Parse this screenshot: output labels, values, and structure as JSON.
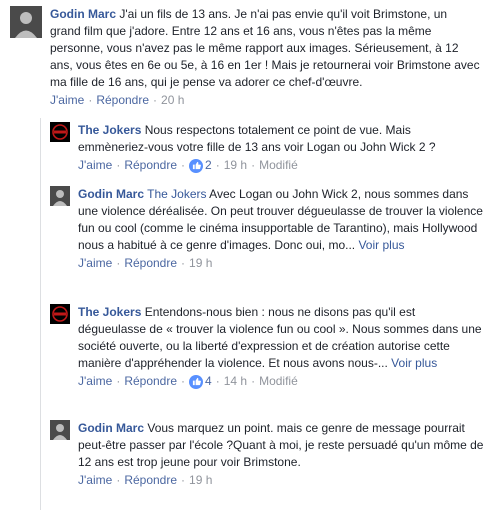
{
  "colors": {
    "link": "#365899",
    "meta": "#90949c",
    "like_badge": "#5890ff"
  },
  "comments": [
    {
      "author": "Godin Marc",
      "mention": "",
      "text": "J'ai un fils de 13 ans. Je n'ai pas envie qu'il voit Brimstone, un grand film que j'adore. Entre 12 ans et 16 ans, vous n'êtes pas la même personne, vous n'avez pas le même rapport aux images. Sérieusement, à 12 ans, vous êtes en 6e ou 5e, à 16 en 1er ! Mais je retournerai voir Brimstone avec ma fille de 16 ans, qui je pense va adorer ce chef-d'œuvre.",
      "seemore": "",
      "like": "J'aime",
      "reply": "Répondre",
      "likes": "",
      "time": "20 h",
      "edited": ""
    },
    {
      "author": "The Jokers",
      "mention": "",
      "text": "Nous respectons totalement ce point de vue. Mais emmèneriez-vous votre fille de 13 ans voir Logan ou John Wick 2 ?",
      "seemore": "",
      "like": "J'aime",
      "reply": "Répondre",
      "likes": "2",
      "time": "19 h",
      "edited": "Modifié"
    },
    {
      "author": "Godin Marc",
      "mention": "The Jokers",
      "text": "Avec Logan ou John Wick 2, nous sommes dans une violence déréalisée. On peut trouver dégueulasse de trouver la violence fun ou cool (comme le cinéma insupportable de Tarantino), mais Hollywood nous a habitué à ce genre d'images. Donc oui, mo...",
      "seemore": "Voir plus",
      "like": "J'aime",
      "reply": "Répondre",
      "likes": "",
      "time": "19 h",
      "edited": ""
    },
    {
      "author": "The Jokers",
      "mention": "",
      "text": "Entendons-nous bien : nous ne disons pas qu'il est dégueulasse de « trouver la violence fun ou cool ». Nous sommes dans une société ouverte, ou la liberté d'expression et de création autorise cette manière d'appréhender la violence. Et nous avons nous-...",
      "seemore": "Voir plus",
      "like": "J'aime",
      "reply": "Répondre",
      "likes": "4",
      "time": "14 h",
      "edited": "Modifié"
    },
    {
      "author": "Godin Marc",
      "mention": "",
      "text": "Vous marquez un point. mais ce genre de message pourrait peut-être passer par l'école ?Quant à moi, je reste persuadé qu'un môme de 12 ans est trop jeune pour voir Brimstone.",
      "seemore": "",
      "like": "J'aime",
      "reply": "Répondre",
      "likes": "",
      "time": "19 h",
      "edited": ""
    }
  ]
}
